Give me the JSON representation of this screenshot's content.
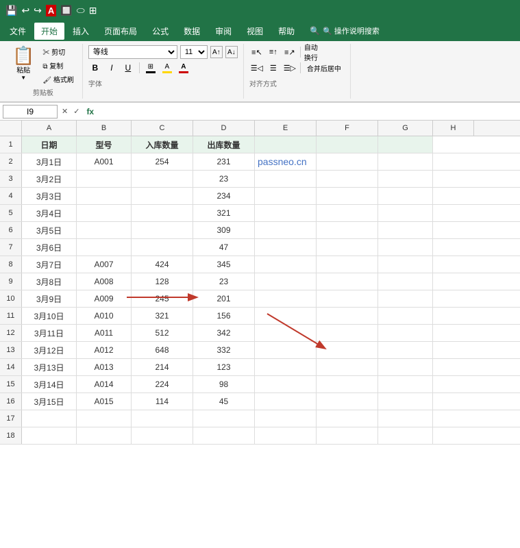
{
  "titlebar": {
    "icons": [
      "💾",
      "↩",
      "↪",
      "A",
      "🔲",
      "⬭"
    ]
  },
  "menubar": {
    "items": [
      "文件",
      "开始",
      "插入",
      "页面布局",
      "公式",
      "数据",
      "审阅",
      "视图",
      "帮助",
      "🔍 操作说明搜索"
    ]
  },
  "ribbon": {
    "clipboard_label": "剪贴板",
    "paste_label": "粘贴",
    "cut_label": "剪切",
    "copy_label": "复制",
    "format_label": "格式刷",
    "font_label": "字体",
    "font_name": "等线",
    "font_size": "11",
    "bold": "B",
    "italic": "I",
    "underline": "U",
    "border_label": "边框",
    "fill_label": "填充",
    "fontcolor_label": "字体颜色",
    "align_label": "对齐方式",
    "wrap_label": "自动换行",
    "merge_label": "合并后居中"
  },
  "formulabar": {
    "cell_ref": "I9",
    "fx": "fx"
  },
  "columns": {
    "widths": [
      32,
      80,
      80,
      90,
      90,
      80,
      80,
      80,
      60
    ],
    "labels": [
      "",
      "A",
      "B",
      "C",
      "D",
      "E",
      "F",
      "G",
      "H"
    ]
  },
  "rows": [
    {
      "num": "1",
      "cells": [
        "日期",
        "型号",
        "入库数量",
        "出库数量",
        "",
        "",
        ""
      ]
    },
    {
      "num": "2",
      "cells": [
        "3月1日",
        "A001",
        "254",
        "231",
        "",
        "",
        ""
      ]
    },
    {
      "num": "3",
      "cells": [
        "3月2日",
        "",
        "",
        "23",
        "",
        "",
        ""
      ]
    },
    {
      "num": "4",
      "cells": [
        "3月3日",
        "",
        "",
        "234",
        "",
        "",
        ""
      ]
    },
    {
      "num": "5",
      "cells": [
        "3月4日",
        "",
        "",
        "321",
        "",
        "",
        ""
      ]
    },
    {
      "num": "6",
      "cells": [
        "3月5日",
        "",
        "",
        "309",
        "",
        "",
        ""
      ]
    },
    {
      "num": "7",
      "cells": [
        "3月6日",
        "",
        "",
        "47",
        "",
        "",
        ""
      ]
    },
    {
      "num": "8",
      "cells": [
        "3月7日",
        "A007",
        "424",
        "345",
        "",
        "",
        ""
      ]
    },
    {
      "num": "9",
      "cells": [
        "3月8日",
        "A008",
        "128",
        "23",
        "",
        "",
        ""
      ]
    },
    {
      "num": "10",
      "cells": [
        "3月9日",
        "A009",
        "245",
        "201",
        "",
        "",
        ""
      ]
    },
    {
      "num": "11",
      "cells": [
        "3月10日",
        "A010",
        "321",
        "156",
        "",
        "",
        ""
      ]
    },
    {
      "num": "12",
      "cells": [
        "3月11日",
        "A011",
        "512",
        "342",
        "",
        "",
        ""
      ]
    },
    {
      "num": "13",
      "cells": [
        "3月12日",
        "A012",
        "648",
        "332",
        "",
        "",
        ""
      ]
    },
    {
      "num": "14",
      "cells": [
        "3月13日",
        "A013",
        "214",
        "123",
        "",
        "",
        ""
      ]
    },
    {
      "num": "15",
      "cells": [
        "3月14日",
        "A014",
        "224",
        "98",
        "",
        "",
        ""
      ]
    },
    {
      "num": "16",
      "cells": [
        "3月15日",
        "A015",
        "114",
        "45",
        "",
        "",
        ""
      ]
    },
    {
      "num": "17",
      "cells": [
        "",
        "",
        "",
        "",
        "",
        "",
        ""
      ]
    },
    {
      "num": "18",
      "cells": [
        "",
        "",
        "",
        "",
        "",
        "",
        ""
      ]
    }
  ],
  "watermark": "passneo.cn",
  "colors": {
    "excel_green": "#217346",
    "header_bg": "#e8f4ec",
    "selected_border": "#217346",
    "watermark": "#4472c4",
    "arrow": "#c0392b"
  }
}
